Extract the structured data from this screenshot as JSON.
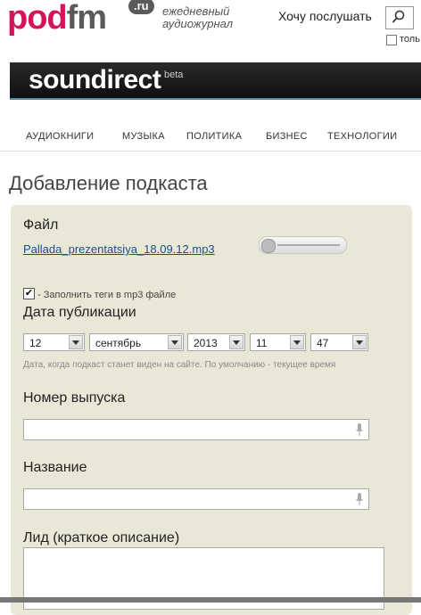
{
  "header": {
    "logo_pod": "pod",
    "logo_fm": "fm",
    "logo_ru": ".ru",
    "tagline_line1": "ежедневный",
    "tagline_line2": "аудиожурнал",
    "want_to_listen": "Хочу послушать",
    "only_label": "толь"
  },
  "banner": {
    "title": "soundirect",
    "beta": "beta"
  },
  "nav": {
    "items": [
      "АУДИОКНИГИ",
      "МУЗЫКА",
      "ПОЛИТИКА",
      "БИЗНЕС",
      "ТЕХНОЛОГИИ"
    ]
  },
  "page": {
    "title": "Добавление подкаста"
  },
  "form": {
    "file_label": "Файл",
    "file_name": "Pallada_prezentatsiya_18.09.12.mp3",
    "fill_tags_checked": true,
    "fill_tags_label": "- Заполнить теги в mp3 файле",
    "date_label": "Дата публикации",
    "date": {
      "day": "12",
      "month": "сентябрь",
      "year": "2013",
      "hour": "11",
      "minute": "47"
    },
    "date_hint": "Дата, когда подкаст станет виден на сайте. По умолчанию - текущее время",
    "issue_label": "Номер выпуска",
    "issue_value": "",
    "title_label": "Название",
    "title_value": "",
    "lead_label": "Лид (краткое описание)",
    "lead_value": ""
  },
  "colors": {
    "brand_pink": "#d4145a",
    "panel_bg": "#e9e8d7",
    "banner_bg": "#1a1a1a",
    "link": "#1a4f8b"
  }
}
